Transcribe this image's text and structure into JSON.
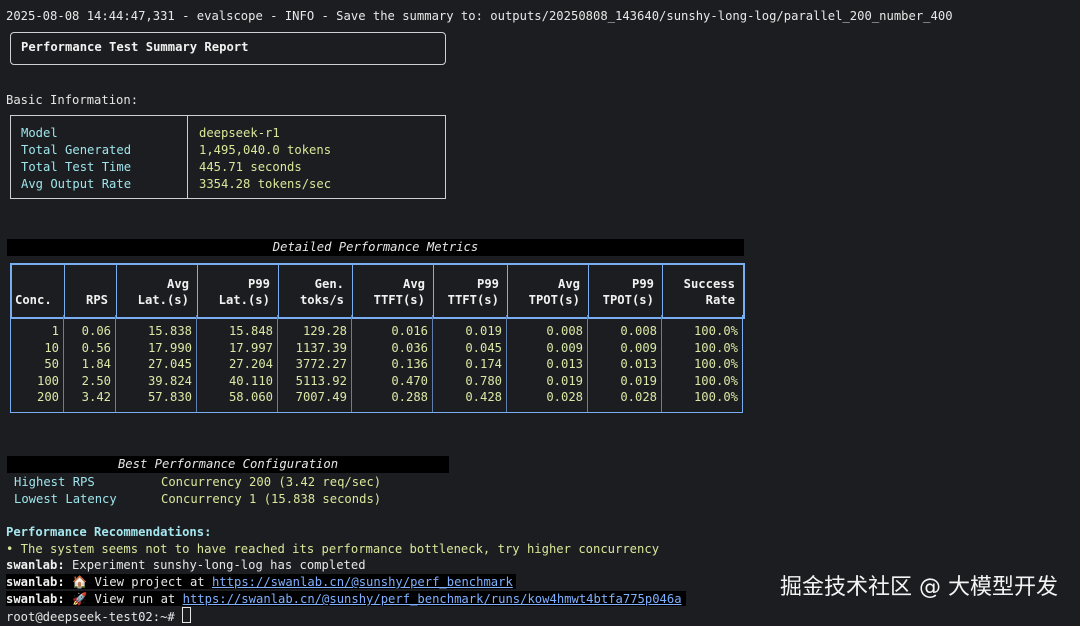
{
  "log": {
    "dashes": "-------------------------------------------------------------------------------------------------------------------------------------------------",
    "line": "2025-08-08 14:44:47,331 - evalscope - INFO - Save the summary to: outputs/20250808_143640/sunshy-long-log/parallel_200_number_400"
  },
  "report": {
    "title": "Performance Test Summary Report"
  },
  "basic_info": {
    "label": "Basic Information:",
    "rows": [
      {
        "key": "Model",
        "value": "deepseek-r1"
      },
      {
        "key": "Total Generated",
        "value": "1,495,040.0 tokens"
      },
      {
        "key": "Total Test Time",
        "value": "445.71 seconds"
      },
      {
        "key": "Avg Output Rate",
        "value": "3354.28 tokens/sec"
      }
    ]
  },
  "metrics": {
    "title": "Detailed Performance Metrics",
    "headers": [
      {
        "line1": "",
        "line2": "Conc."
      },
      {
        "line1": "",
        "line2": "RPS"
      },
      {
        "line1": "Avg",
        "line2": "Lat.(s)"
      },
      {
        "line1": "P99",
        "line2": "Lat.(s)"
      },
      {
        "line1": "Gen.",
        "line2": "toks/s"
      },
      {
        "line1": "Avg",
        "line2": "TTFT(s)"
      },
      {
        "line1": "P99",
        "line2": "TTFT(s)"
      },
      {
        "line1": "Avg",
        "line2": "TPOT(s)"
      },
      {
        "line1": "P99",
        "line2": "TPOT(s)"
      },
      {
        "line1": "Success",
        "line2": "Rate"
      }
    ],
    "rows": [
      [
        "1",
        "0.06",
        "15.838",
        "15.848",
        "129.28",
        "0.016",
        "0.019",
        "0.008",
        "0.008",
        "100.0%"
      ],
      [
        "10",
        "0.56",
        "17.990",
        "17.997",
        "1137.39",
        "0.036",
        "0.045",
        "0.009",
        "0.009",
        "100.0%"
      ],
      [
        "50",
        "1.84",
        "27.045",
        "27.204",
        "3772.27",
        "0.136",
        "0.174",
        "0.013",
        "0.013",
        "100.0%"
      ],
      [
        "100",
        "2.50",
        "39.824",
        "40.110",
        "5113.92",
        "0.470",
        "0.780",
        "0.019",
        "0.019",
        "100.0%"
      ],
      [
        "200",
        "3.42",
        "57.830",
        "58.060",
        "7007.49",
        "0.288",
        "0.428",
        "0.028",
        "0.028",
        "100.0%"
      ]
    ]
  },
  "best": {
    "title": "Best Performance Configuration",
    "rows": [
      {
        "key": "Highest RPS",
        "value": "Concurrency 200 (3.42 req/sec)"
      },
      {
        "key": "Lowest Latency",
        "value": "Concurrency 1 (15.838 seconds)"
      }
    ]
  },
  "recommendations": {
    "title": "Performance Recommendations:",
    "items": [
      "• The system seems not to have reached its performance bottleneck, try higher concurrency"
    ]
  },
  "swanlab": {
    "prefix": "swanlab:",
    "completed": "Experiment sunshy-long-log has completed",
    "project_text": "🏠 View project at ",
    "project_url": "https://swanlab.cn/@sunshy/perf_benchmark",
    "run_text": "🚀 View run at ",
    "run_url": "https://swanlab.cn/@sunshy/perf_benchmark/runs/kow4hmwt4btfa775p046a"
  },
  "prompt": "root@deepseek-test02:~# ",
  "watermark": "掘金技术社区 @ 大模型开发",
  "colors": {
    "background": "#1b1d20",
    "key_cyan": "#9fe4ec",
    "value_yellow": "#d7e89a",
    "table_border": "#7aaef2",
    "link": "#7fb0ff"
  }
}
